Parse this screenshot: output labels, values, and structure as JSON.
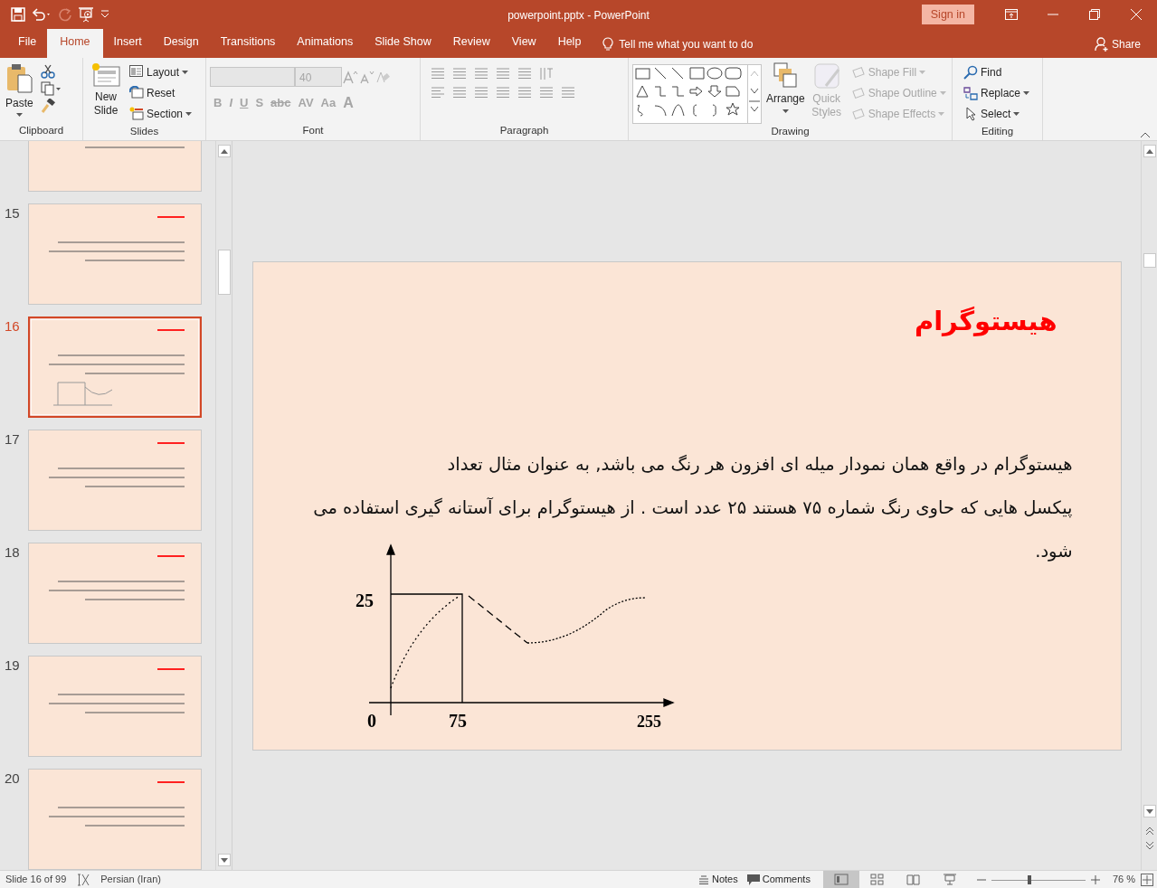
{
  "window": {
    "title": "powerpoint.pptx  -  PowerPoint",
    "sign_in": "Sign in"
  },
  "tabs": [
    {
      "label": "File",
      "selected": false
    },
    {
      "label": "Home",
      "selected": true
    },
    {
      "label": "Insert",
      "selected": false
    },
    {
      "label": "Design",
      "selected": false
    },
    {
      "label": "Transitions",
      "selected": false
    },
    {
      "label": "Animations",
      "selected": false
    },
    {
      "label": "Slide Show",
      "selected": false
    },
    {
      "label": "Review",
      "selected": false
    },
    {
      "label": "View",
      "selected": false
    },
    {
      "label": "Help",
      "selected": false
    }
  ],
  "tell_me": "Tell me what you want to do",
  "share": "Share",
  "ribbon": {
    "clipboard": {
      "label": "Clipboard",
      "paste": "Paste"
    },
    "slides": {
      "label": "Slides",
      "new_slide": "New Slide",
      "layout": "Layout",
      "reset": "Reset",
      "section": "Section"
    },
    "font": {
      "label": "Font",
      "size": "40",
      "buttons": [
        "B",
        "I",
        "U",
        "S",
        "abc",
        "AV",
        "Aa",
        "A"
      ]
    },
    "paragraph": {
      "label": "Paragraph"
    },
    "drawing": {
      "label": "Drawing",
      "arrange": "Arrange",
      "quick_styles": "Quick Styles",
      "commands": [
        {
          "label": "Shape Fill",
          "disabled": true
        },
        {
          "label": "Shape Outline",
          "disabled": true
        },
        {
          "label": "Shape Effects",
          "disabled": true
        }
      ]
    },
    "editing": {
      "label": "Editing",
      "find": "Find",
      "replace": "Replace",
      "select": "Select"
    }
  },
  "thumbnails": [
    {
      "selected": false
    },
    {
      "number": "15",
      "selected": false
    },
    {
      "number": "16",
      "selected": true
    },
    {
      "number": "17",
      "selected": false
    },
    {
      "number": "18",
      "selected": false
    },
    {
      "number": "19",
      "selected": false
    },
    {
      "number": "20",
      "selected": false
    }
  ],
  "slide": {
    "title": "هیستوگرام",
    "paragraphs": [
      "هیستوگرام در واقع همان نمودار میله ای افزون هر رنگ می باشد, به عنوان مثال تعداد",
      "پیکسل هایی که حاوی رنگ شماره ۷۵ هستند ۲۵ عدد است . از هیستوگرام برای آستانه گیری استفاده می شود."
    ],
    "figure_labels": [
      "25",
      "0",
      "75",
      "255"
    ]
  },
  "status_bar": {
    "slide": "Slide 16 of 99",
    "language": "Persian (Iran)",
    "notes": "Notes",
    "comments": "Comments",
    "views": [
      {
        "kind": "normal",
        "selected": true
      },
      {
        "kind": "sorter",
        "selected": false
      },
      {
        "kind": "reading",
        "selected": false
      },
      {
        "kind": "slideshow",
        "selected": false
      }
    ],
    "zoom": {
      "level": 0.4,
      "reading": "76 %"
    }
  }
}
